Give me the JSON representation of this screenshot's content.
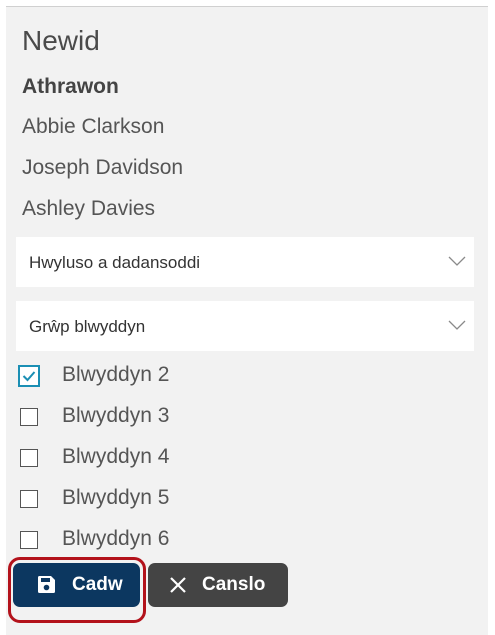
{
  "panel": {
    "title": "Newid",
    "teachers_heading": "Athrawon",
    "teachers": [
      "Abbie Clarkson",
      "Joseph Davidson",
      "Ashley Davies"
    ]
  },
  "filters": {
    "category_select": {
      "selected": "Hwyluso a dadansoddi",
      "icon": "chevron-down-icon"
    },
    "group_select": {
      "selected": "Grŵp blwyddyn",
      "icon": "chevron-down-icon"
    }
  },
  "year_groups": [
    {
      "label": "Blwyddyn 2",
      "checked": true
    },
    {
      "label": "Blwyddyn 3",
      "checked": false
    },
    {
      "label": "Blwyddyn 4",
      "checked": false
    },
    {
      "label": "Blwyddyn 5",
      "checked": false
    },
    {
      "label": "Blwyddyn 6",
      "checked": false
    }
  ],
  "actions": {
    "save_label": "Cadw",
    "save_icon": "floppy-disk-icon",
    "cancel_label": "Canslo",
    "cancel_icon": "close-icon"
  },
  "colors": {
    "save_button": "#0c3760",
    "cancel_button": "#444444",
    "highlight_outline": "#b3121b",
    "checkbox_accent": "#1b8fb4"
  }
}
